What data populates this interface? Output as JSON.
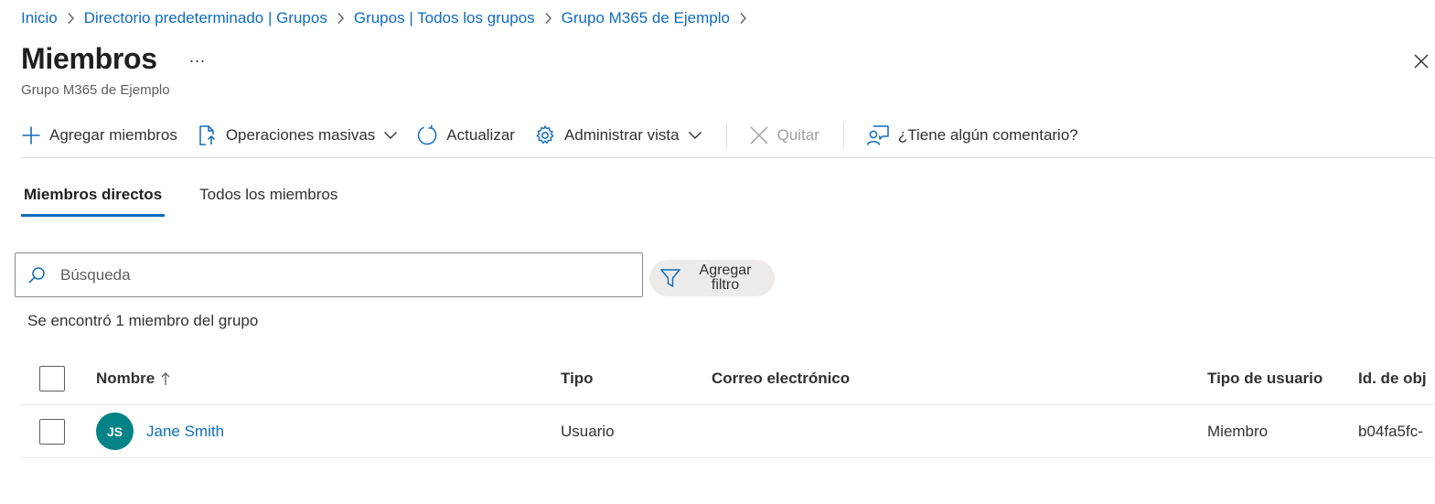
{
  "breadcrumb": [
    {
      "label": "Inicio"
    },
    {
      "label": "Directorio predeterminado | Grupos"
    },
    {
      "label": "Grupos | Todos los grupos"
    },
    {
      "label": "Grupo M365 de Ejemplo"
    }
  ],
  "header": {
    "title": "Miembros",
    "more": "...",
    "subtitle": "Grupo M365 de Ejemplo"
  },
  "toolbar": {
    "add_members": "Agregar miembros",
    "bulk_operations": "Operaciones masivas",
    "refresh": "Actualizar",
    "manage_view": "Administrar vista",
    "remove": "Quitar",
    "feedback": "¿Tiene algún comentario?"
  },
  "tabs": [
    {
      "label": "Miembros directos",
      "active": true
    },
    {
      "label": "Todos los miembros",
      "active": false
    }
  ],
  "search": {
    "placeholder": "Búsqueda",
    "value": ""
  },
  "filter": {
    "label": "Agregar filtro"
  },
  "result_count": "Se encontró 1 miembro del grupo",
  "table": {
    "columns": {
      "name": "Nombre",
      "type": "Tipo",
      "email": "Correo electrónico",
      "user_type": "Tipo de usuario",
      "object_id": "Id. de obj"
    },
    "rows": [
      {
        "initials": "JS",
        "name": "Jane Smith",
        "type": "Usuario",
        "email": "",
        "user_type": "Miembro",
        "object_id": "b04fa5fc-"
      }
    ]
  },
  "colors": {
    "accent": "#0f6cbd",
    "avatar": "#038387",
    "disabled": "#a19f9d"
  },
  "icons": {
    "chevron": "chevron-right-icon",
    "add": "plus-icon",
    "bulk": "document-upload-icon",
    "refresh": "refresh-icon",
    "settings": "gear-icon",
    "remove": "close-icon",
    "feedback": "feedback-person-icon",
    "search": "search-icon",
    "filter": "funnel-icon",
    "sort": "arrow-up-icon"
  }
}
